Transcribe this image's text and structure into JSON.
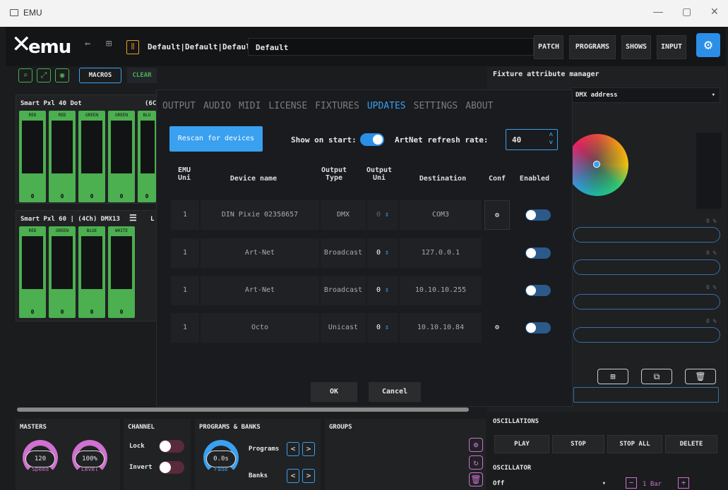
{
  "window": {
    "title": "EMU",
    "min": "—",
    "max": "▢",
    "close": "✕"
  },
  "header": {
    "logo": "emu",
    "config": "Default|Default|Default",
    "config_name": "Default",
    "nav": [
      "PATCH",
      "PROGRAMS",
      "SHOWS",
      "INPUT"
    ]
  },
  "toolbar": {
    "macros": "MACROS",
    "clear": "CLEAR"
  },
  "fixtures": [
    {
      "title": "Smart Pxl 40 Dot",
      "extra": "(6C",
      "channels": [
        {
          "name": "RED",
          "value": "0"
        },
        {
          "name": "RED",
          "value": "0"
        },
        {
          "name": "GREEN",
          "value": "0"
        },
        {
          "name": "GREEN",
          "value": "0"
        },
        {
          "name": "BLU",
          "value": "0"
        }
      ]
    },
    {
      "title": "Smart Pxl 60 | (4Ch) DMX13",
      "extra": "L",
      "channels": [
        {
          "name": "RED",
          "value": "0"
        },
        {
          "name": "GREEN",
          "value": "0"
        },
        {
          "name": "BLUE",
          "value": "0"
        },
        {
          "name": "WHITE",
          "value": "0"
        }
      ]
    }
  ],
  "right": {
    "title": "Fixture attribute manager",
    "dmx": "DMX address",
    "pcts": [
      "0 %",
      "0 %",
      "0 %",
      "0 %"
    ]
  },
  "oscillations": {
    "title": "OSCILLATIONS",
    "buttons": [
      "PLAY",
      "STOP",
      "STOP ALL",
      "DELETE"
    ],
    "osc_title": "OSCILLATOR",
    "osc_value": "Off",
    "bar": "1 Bar"
  },
  "masters": {
    "title": "MASTERS",
    "speed": "120",
    "speed_label": "Speed",
    "level": "100%",
    "level_label": "Level"
  },
  "channel": {
    "title": "CHANNEL",
    "lock": "Lock",
    "invert": "Invert"
  },
  "programs": {
    "title": "PROGRAMS & BANKS",
    "fade": "0.0s",
    "fade_label": "Fade",
    "programs": "Programs",
    "banks": "Banks"
  },
  "groups": {
    "title": "GROUPS"
  },
  "modal": {
    "tabs": [
      "OUTPUT",
      "AUDIO",
      "MIDI",
      "LICENSE",
      "FIXTURES",
      "UPDATES",
      "SETTINGS",
      "ABOUT"
    ],
    "active_tab": "UPDATES",
    "rescan": "Rescan for devices",
    "show_on_start": "Show on start:",
    "artnet_label": "ArtNet refresh rate:",
    "artnet_value": "40",
    "columns": [
      "EMU Uni",
      "Device name",
      "Output Type",
      "Output Uni",
      "Destination",
      "Conf",
      "Enabled"
    ],
    "rows": [
      {
        "uni": "1",
        "device": "DIN Pixie 02358657",
        "type": "DMX",
        "out": "0",
        "dest": "COM3",
        "conf": true
      },
      {
        "uni": "1",
        "device": "Art-Net",
        "type": "Broadcast",
        "out": "0",
        "dest": "127.0.0.1",
        "conf": false
      },
      {
        "uni": "1",
        "device": "Art-Net",
        "type": "Broadcast",
        "out": "0",
        "dest": "10.10.10.255",
        "conf": false
      },
      {
        "uni": "1",
        "device": "Octo",
        "type": "Unicast",
        "out": "0",
        "dest": "10.10.10.84",
        "conf": true
      }
    ],
    "ok": "OK",
    "cancel": "Cancel"
  }
}
